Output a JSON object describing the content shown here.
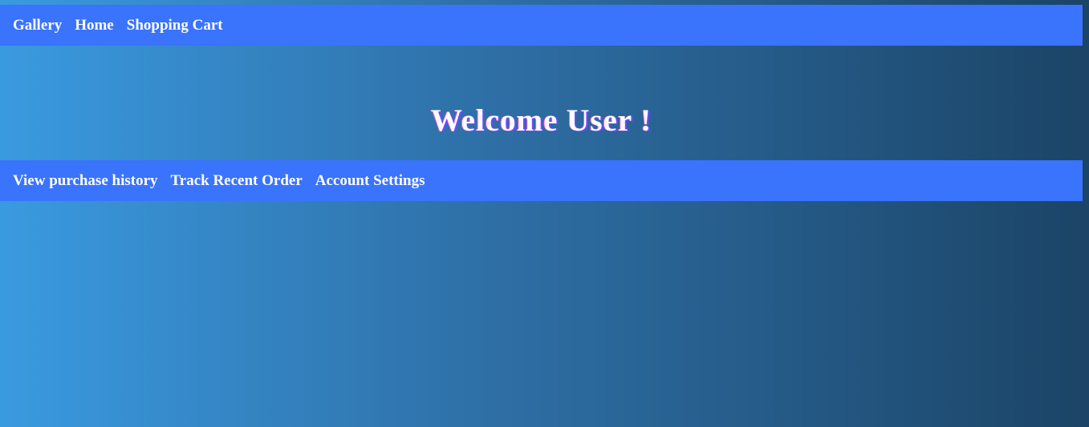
{
  "top_nav": {
    "items": [
      {
        "label": "Gallery"
      },
      {
        "label": "Home"
      },
      {
        "label": "Shopping Cart"
      }
    ]
  },
  "main": {
    "welcome_text": "Welcome User !"
  },
  "account_nav": {
    "items": [
      {
        "label": "View purchase history"
      },
      {
        "label": "Track Recent Order"
      },
      {
        "label": "Account Settings"
      }
    ]
  },
  "colors": {
    "nav_background": "#3a73fc",
    "gradient_start": "#3a9ae0",
    "gradient_end": "#1b4466",
    "text": "#ffffff"
  }
}
